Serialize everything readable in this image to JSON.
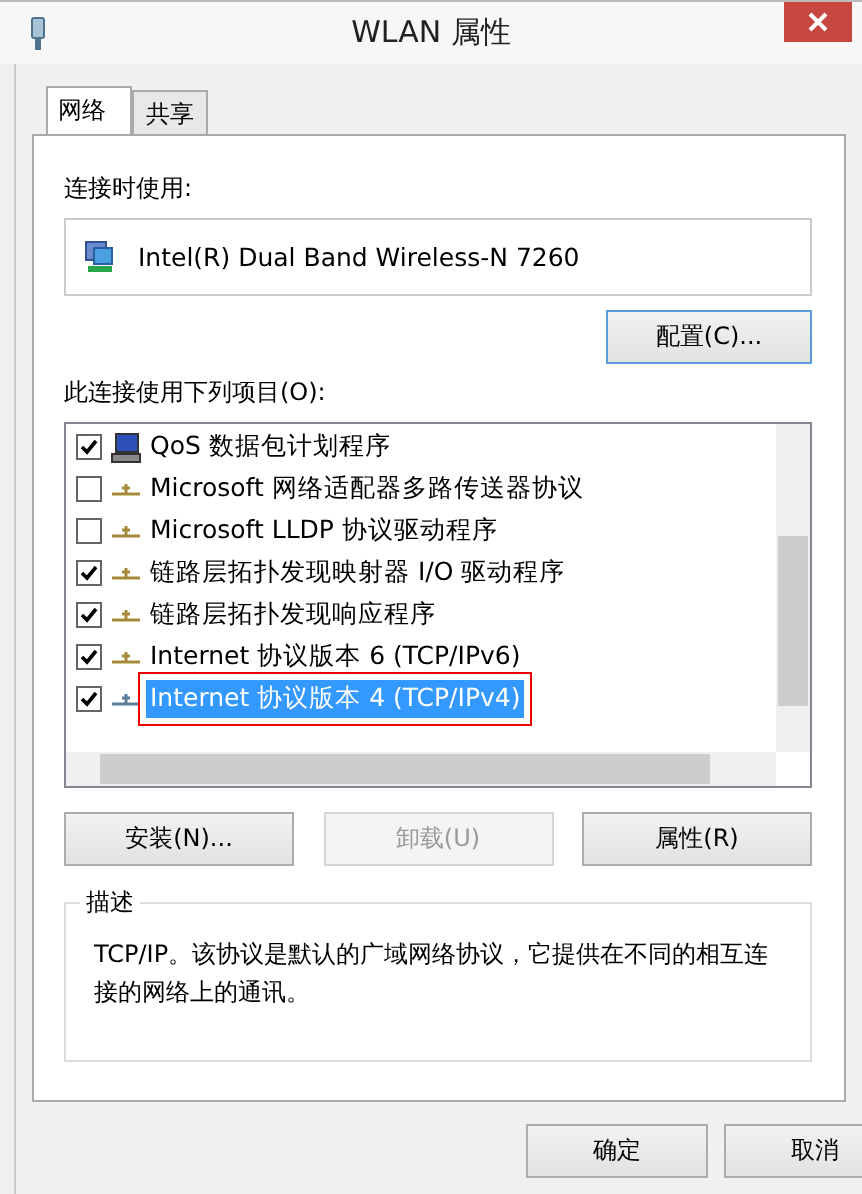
{
  "window": {
    "title": "WLAN 属性"
  },
  "tabs": [
    {
      "label": "网络",
      "selected": true
    },
    {
      "label": "共享",
      "selected": false
    }
  ],
  "connect_using": {
    "label": "连接时使用:",
    "adapter": "Intel(R) Dual Band Wireless-N 7260",
    "configure_button": "配置(C)..."
  },
  "items_label": "此连接使用下列项目(O):",
  "items": [
    {
      "label": "QoS 数据包计划程序",
      "checked": true,
      "selected": false,
      "kind": "service"
    },
    {
      "label": "Microsoft 网络适配器多路传送器协议",
      "checked": false,
      "selected": false,
      "kind": "protocol"
    },
    {
      "label": "Microsoft LLDP 协议驱动程序",
      "checked": false,
      "selected": false,
      "kind": "protocol"
    },
    {
      "label": "链路层拓扑发现映射器 I/O 驱动程序",
      "checked": true,
      "selected": false,
      "kind": "protocol"
    },
    {
      "label": "链路层拓扑发现响应程序",
      "checked": true,
      "selected": false,
      "kind": "protocol"
    },
    {
      "label": "Internet 协议版本 6 (TCP/IPv6)",
      "checked": true,
      "selected": false,
      "kind": "protocol"
    },
    {
      "label": "Internet 协议版本 4 (TCP/IPv4)",
      "checked": true,
      "selected": true,
      "kind": "protocol"
    }
  ],
  "item_buttons": [
    {
      "label": "安装(N)...",
      "disabled": false
    },
    {
      "label": "卸载(U)",
      "disabled": true
    },
    {
      "label": "属性(R)",
      "disabled": false
    }
  ],
  "description": {
    "title": "描述",
    "text": "TCP/IP。该协议是默认的广域网络协议，它提供在不同的相互连接的网络上的通讯。"
  },
  "dialog_buttons": [
    "确定",
    "取消"
  ]
}
